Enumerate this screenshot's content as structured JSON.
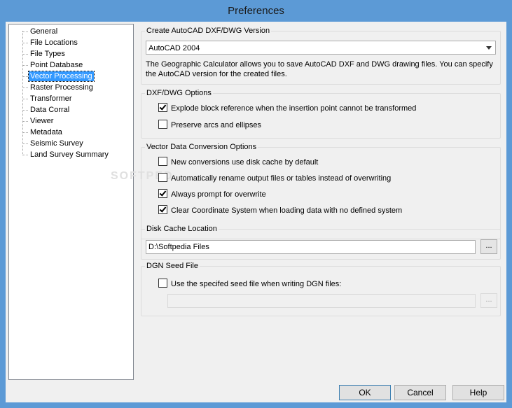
{
  "window": {
    "title": "Preferences"
  },
  "tree": {
    "items": [
      "General",
      "File Locations",
      "File Types",
      "Point Database",
      "Vector Processing",
      "Raster Processing",
      "Transformer",
      "Data Corral",
      "Viewer",
      "Metadata",
      "Seismic Survey",
      "Land Survey Summary"
    ],
    "selected": "Vector Processing",
    "watermark": "SOFTPED"
  },
  "autocad": {
    "title": "Create AutoCAD DXF/DWG Version",
    "selected_version": "AutoCAD 2004",
    "description": "The Geographic Calculator allows you to save AutoCAD DXF and DWG drawing files.  You can specify the AutoCAD version for the created files."
  },
  "dxf_options": {
    "title": "DXF/DWG Options",
    "explode_label": "Explode block reference when the insertion point cannot be transformed",
    "explode_checked": true,
    "arcs_label": "Preserve arcs and ellipses",
    "arcs_checked": false
  },
  "vector_options": {
    "title": "Vector Data Conversion Options",
    "disk_cache_label": "New conversions use disk cache by default",
    "disk_cache_checked": false,
    "rename_label": "Automatically rename output files or tables instead of overwriting",
    "rename_checked": false,
    "prompt_label": "Always prompt for overwrite",
    "prompt_checked": true,
    "clear_cs_label": "Clear Coordinate System when loading data with no defined system",
    "clear_cs_checked": true
  },
  "disk_cache": {
    "title": "Disk Cache Location",
    "path": "D:\\Softpedia Files",
    "browse_label": "..."
  },
  "dgn_seed": {
    "title": "DGN Seed File",
    "use_label": "Use the specifed seed file when writing DGN files:",
    "use_checked": false,
    "path": "",
    "browse_label": "..."
  },
  "buttons": {
    "ok": "OK",
    "cancel": "Cancel",
    "help": "Help"
  }
}
